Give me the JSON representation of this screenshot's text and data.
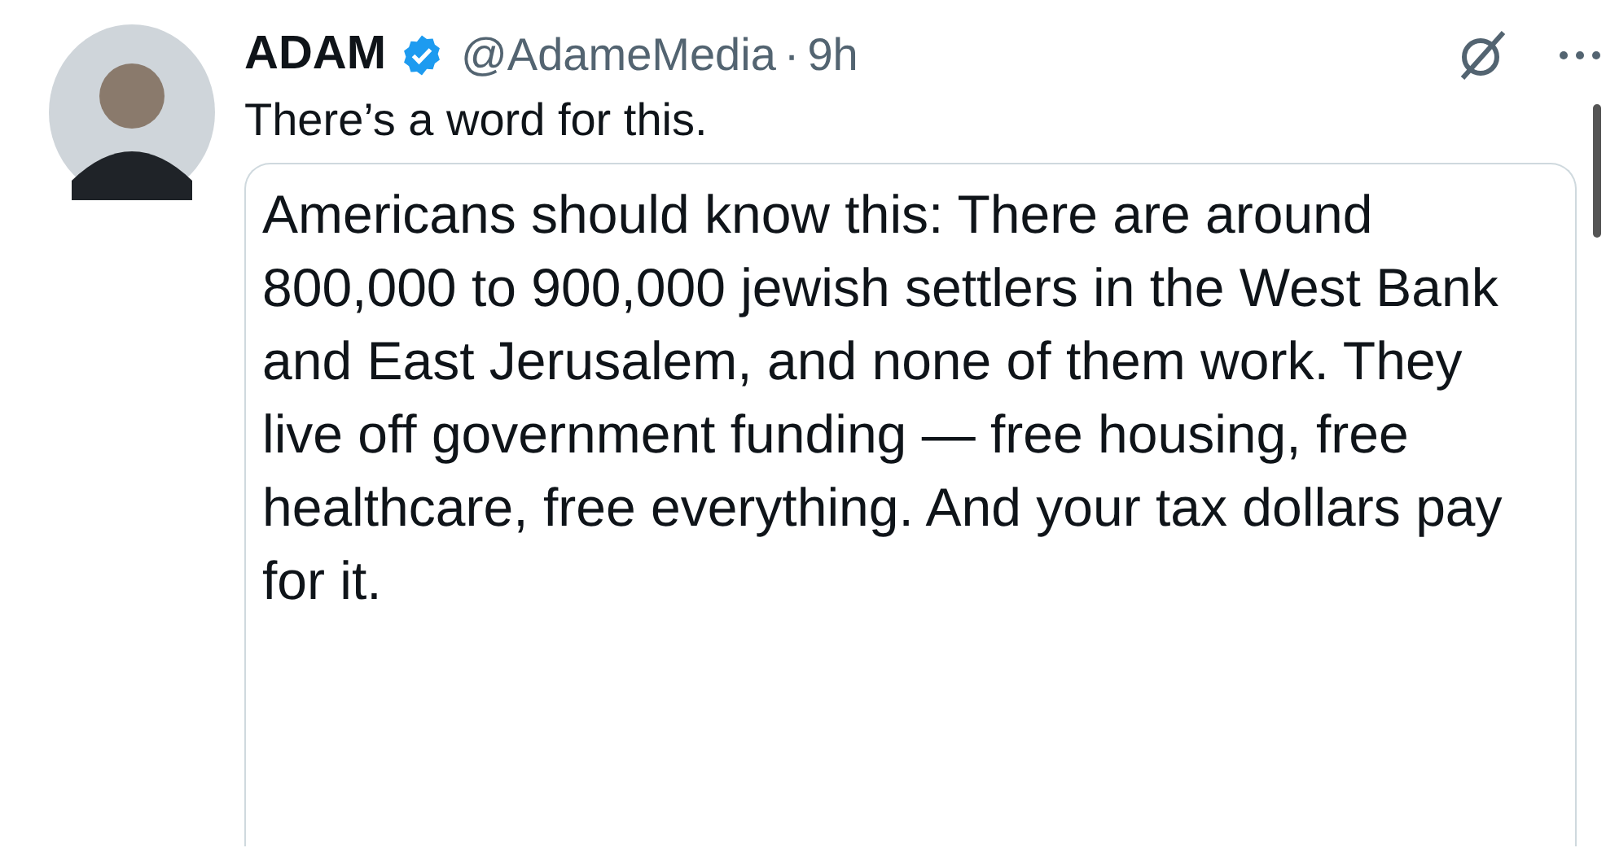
{
  "post": {
    "author": {
      "name": "ADAM",
      "verified": true,
      "handle": "@AdameMedia",
      "separator": "·",
      "time": "9h"
    },
    "text": "There’s a word for this.",
    "quoted": {
      "text": "Americans should know this: There are around 800,000 to 900,000 jewish settlers in the West Bank and East Jerusalem, and none of them work. They live off government funding — free housing, free healthcare, free everything. And your tax dollars pay for it."
    }
  }
}
